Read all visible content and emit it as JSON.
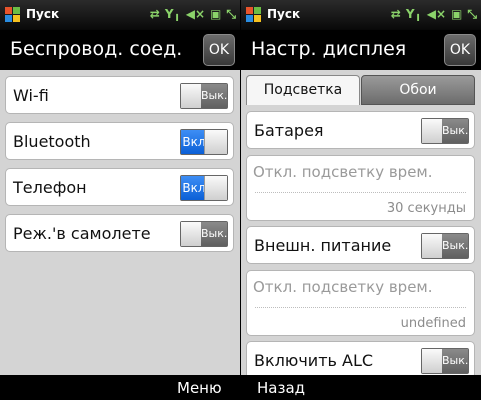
{
  "status": {
    "start_label": "Пуск",
    "icons": [
      "sync-icon",
      "signal-icon",
      "volume-icon",
      "battery-icon",
      "resize-icon"
    ]
  },
  "left": {
    "title": "Беспровод. соед.",
    "ok": "OK",
    "rows": [
      {
        "label": "Wi-fi",
        "state": "Вык."
      },
      {
        "label": "Bluetooth",
        "state": "Вкл"
      },
      {
        "label": "Телефон",
        "state": "Вкл"
      },
      {
        "label": "Реж.'в самолете",
        "state": "Вык."
      }
    ]
  },
  "right": {
    "title": "Настр. дисплея",
    "ok": "OK",
    "tabs": [
      "Подсветка",
      "Обои"
    ],
    "battery_label": "Батарея",
    "battery_state": "Вык.",
    "battery_timeout_label": "Откл. подсветку врем.",
    "battery_timeout_value": "30 секунды",
    "external_label": "Внешн. питание",
    "external_state": "Вык.",
    "external_timeout_label": "Откл. подсветку врем.",
    "external_timeout_value": "undefined",
    "alc_label": "Включить ALC",
    "alc_state": "Вык."
  },
  "softkeys": {
    "left": "Меню",
    "right": "Назад"
  }
}
